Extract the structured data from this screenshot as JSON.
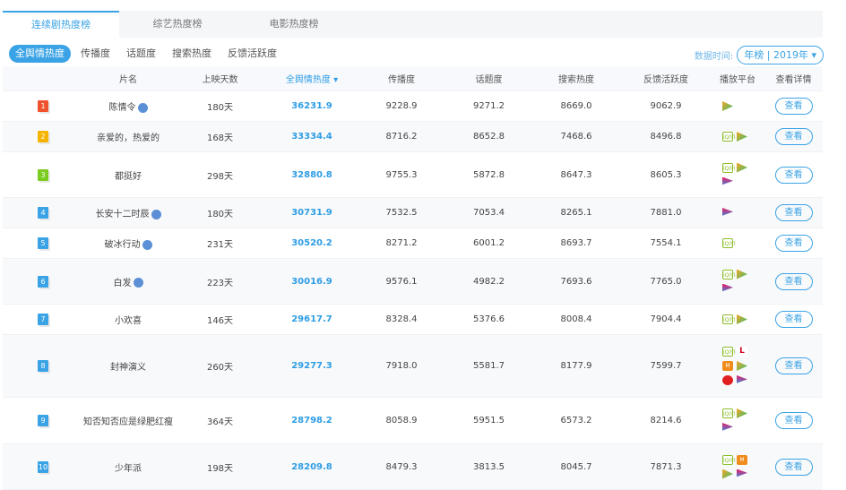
{
  "tabs": [
    "连续剧热度榜",
    "综艺热度榜",
    "电影热度榜"
  ],
  "subtabs": [
    "全舆情热度",
    "传播度",
    "话题度",
    "搜索热度",
    "反馈活跃度"
  ],
  "time": {
    "label": "数据时间:",
    "value": "年榜 | 2019年 ▾"
  },
  "headers": [
    "",
    "片名",
    "上映天数",
    "全舆情热度 ▾",
    "传播度",
    "话题度",
    "搜索热度",
    "反馈活跃度",
    "播放平台",
    "查看详情"
  ],
  "view_label": "查看",
  "rank_colors": [
    "#f0522d",
    "#f5b400",
    "#7ccb1f",
    "#3aa3e6"
  ],
  "rows": [
    {
      "rank": "1",
      "title": "陈情令",
      "badge": true,
      "days": "180天",
      "heat": "36231.9",
      "spread": "9228.9",
      "topic": "9271.2",
      "search": "8669.0",
      "feedback": "9062.9",
      "platforms": [
        "tencent"
      ],
      "h": 34
    },
    {
      "rank": "2",
      "title": "亲爱的，热爱的",
      "badge": false,
      "days": "168天",
      "heat": "33334.4",
      "spread": "8716.2",
      "topic": "8652.8",
      "search": "7468.6",
      "feedback": "8496.8",
      "platforms": [
        "iqiyi",
        "tencent"
      ],
      "h": 34
    },
    {
      "rank": "3",
      "title": "都挺好",
      "badge": false,
      "days": "298天",
      "heat": "32880.8",
      "spread": "9755.3",
      "topic": "5872.8",
      "search": "8647.3",
      "feedback": "8605.3",
      "platforms": [
        "iqiyi",
        "tencent",
        "youku"
      ],
      "h": 51
    },
    {
      "rank": "4",
      "title": "长安十二时辰",
      "badge": true,
      "days": "180天",
      "heat": "30731.9",
      "spread": "7532.5",
      "topic": "7053.4",
      "search": "8265.1",
      "feedback": "7881.0",
      "platforms": [
        "youku"
      ],
      "h": 34
    },
    {
      "rank": "5",
      "title": "破冰行动",
      "badge": true,
      "days": "231天",
      "heat": "30520.2",
      "spread": "8271.2",
      "topic": "6001.2",
      "search": "8693.7",
      "feedback": "7554.1",
      "platforms": [
        "iqiyi"
      ],
      "h": 34
    },
    {
      "rank": "6",
      "title": "白发",
      "badge": true,
      "days": "223天",
      "heat": "30016.9",
      "spread": "9576.1",
      "topic": "4982.2",
      "search": "7693.6",
      "feedback": "7765.0",
      "platforms": [
        "iqiyi",
        "tencent",
        "youku"
      ],
      "h": 51
    },
    {
      "rank": "7",
      "title": "小欢喜",
      "badge": false,
      "days": "146天",
      "heat": "29617.7",
      "spread": "8328.4",
      "topic": "5376.6",
      "search": "8008.4",
      "feedback": "7904.4",
      "platforms": [
        "iqiyi",
        "tencent"
      ],
      "h": 34
    },
    {
      "rank": "8",
      "title": "封神演义",
      "badge": false,
      "days": "260天",
      "heat": "29277.3",
      "spread": "7918.0",
      "topic": "5581.7",
      "search": "8177.9",
      "feedback": "7599.7",
      "platforms": [
        "iqiyi",
        "letv",
        "mango",
        "tencent",
        "sohu",
        "youku"
      ],
      "h": 70
    },
    {
      "rank": "9",
      "title": "知否知否应是绿肥红瘦",
      "badge": false,
      "days": "364天",
      "heat": "28798.2",
      "spread": "8058.9",
      "topic": "5951.5",
      "search": "6573.2",
      "feedback": "8214.6",
      "platforms": [
        "iqiyi",
        "tencent",
        "youku"
      ],
      "h": 52
    },
    {
      "rank": "10",
      "title": "少年派",
      "badge": false,
      "days": "198天",
      "heat": "28209.8",
      "spread": "8479.3",
      "topic": "3813.5",
      "search": "8045.7",
      "feedback": "7871.3",
      "platforms": [
        "iqiyi",
        "mango",
        "tencent",
        "youku"
      ],
      "h": 51
    }
  ]
}
